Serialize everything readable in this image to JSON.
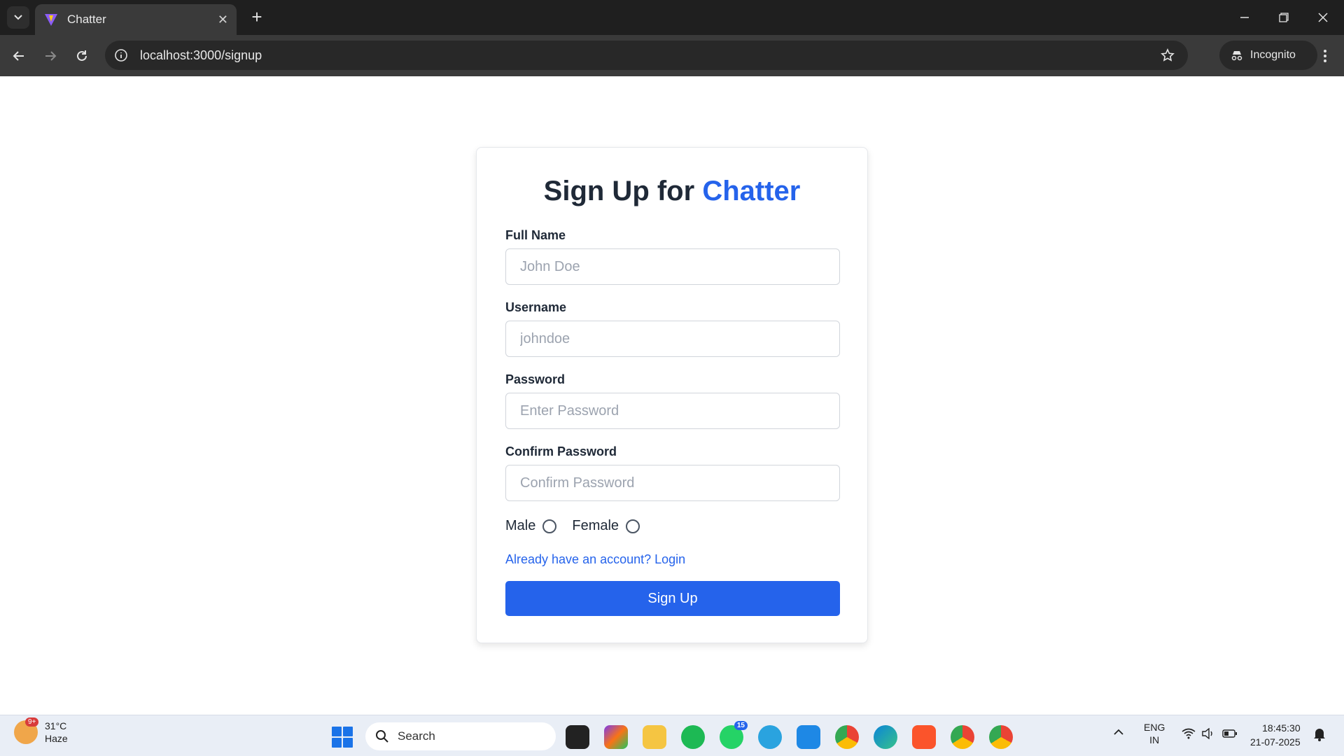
{
  "browser": {
    "tab_title": "Chatter",
    "url": "localhost:3000/signup",
    "incognito_label": "Incognito"
  },
  "form": {
    "heading_prefix": "Sign Up for",
    "heading_brand": "Chatter",
    "fields": [
      {
        "label": "Full Name",
        "placeholder": "John Doe"
      },
      {
        "label": "Username",
        "placeholder": "johndoe"
      },
      {
        "label": "Password",
        "placeholder": "Enter Password"
      },
      {
        "label": "Confirm Password",
        "placeholder": "Confirm Password"
      }
    ],
    "gender": {
      "male": "Male",
      "female": "Female"
    },
    "login_link": "Already have an account? Login",
    "submit_label": "Sign Up",
    "accent_color": "#2563eb"
  },
  "taskbar": {
    "weather_badge": "9+",
    "temperature": "31°C",
    "condition": "Haze",
    "search_label": "Search",
    "whatsapp_badge": "15",
    "lang_top": "ENG",
    "lang_bottom": "IN",
    "time": "18:45:30",
    "date": "21-07-2025"
  }
}
